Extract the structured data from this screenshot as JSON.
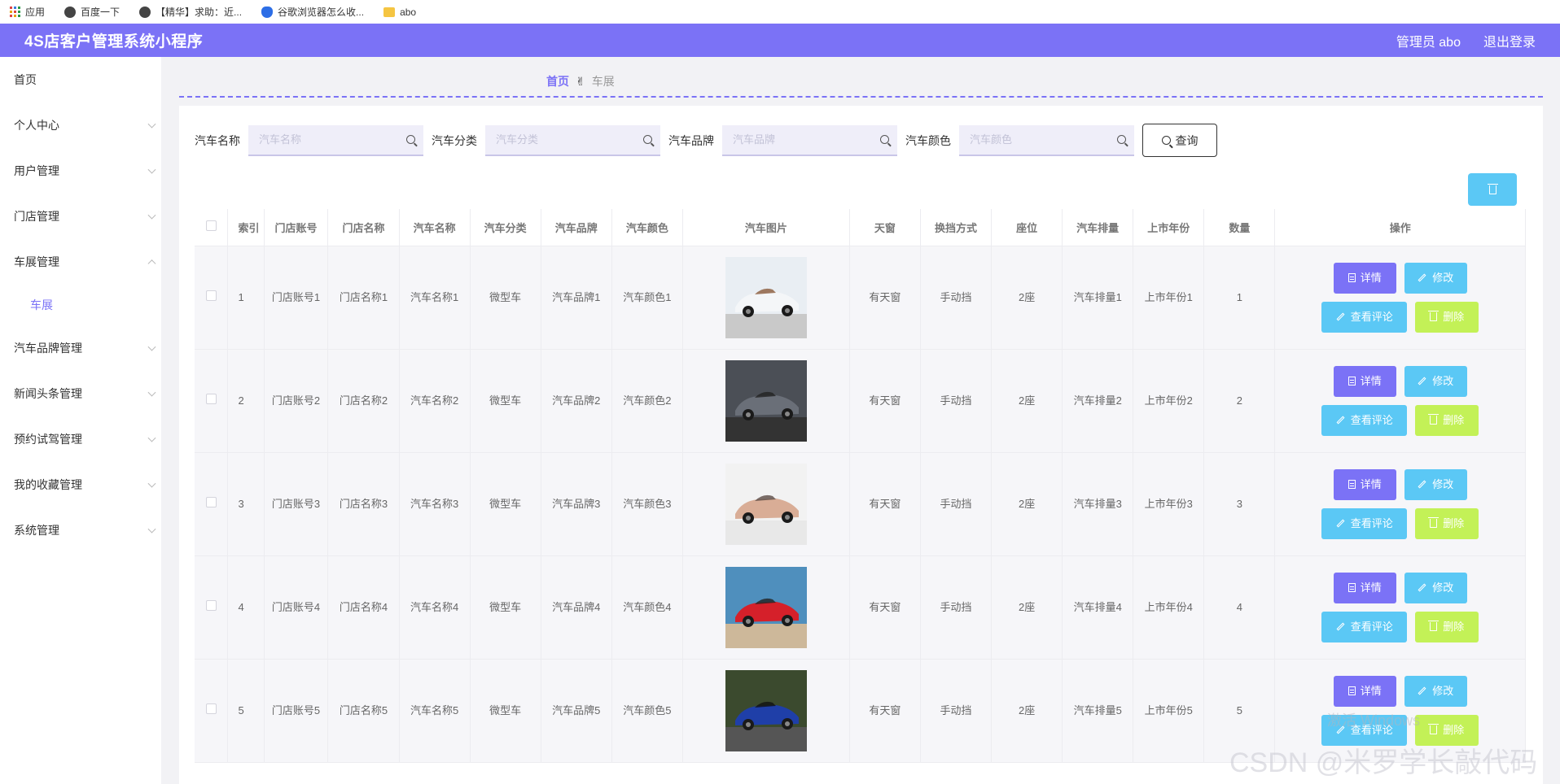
{
  "bookmarks": [
    {
      "label": "应用",
      "icon": "apps-grid-icon"
    },
    {
      "label": "百度一下",
      "icon": "globe-icon"
    },
    {
      "label": "【精华】求助：近...",
      "icon": "globe-icon"
    },
    {
      "label": "谷歌浏览器怎么收...",
      "icon": "baidu-paw-icon"
    },
    {
      "label": "abo",
      "icon": "folder-icon"
    }
  ],
  "header": {
    "title": "4S店客户管理系统小程序",
    "admin_label": "管理员 abo",
    "logout_label": "退出登录",
    "color": "#7b72f6"
  },
  "sidebar": {
    "items": [
      {
        "label": "首页",
        "expandable": false
      },
      {
        "label": "个人中心",
        "expandable": true
      },
      {
        "label": "用户管理",
        "expandable": true
      },
      {
        "label": "门店管理",
        "expandable": true
      },
      {
        "label": "车展管理",
        "expandable": true,
        "expanded": true
      },
      {
        "label": "车展",
        "sub": true,
        "active": true
      },
      {
        "label": "汽车品牌管理",
        "expandable": true
      },
      {
        "label": "新闻头条管理",
        "expandable": true
      },
      {
        "label": "预约试驾管理",
        "expandable": true
      },
      {
        "label": "我的收藏管理",
        "expandable": true
      },
      {
        "label": "系统管理",
        "expandable": true
      }
    ]
  },
  "breadcrumb": {
    "home": "首页",
    "separator": "✌",
    "current": "车展"
  },
  "search": {
    "fields": [
      {
        "label": "汽车名称",
        "placeholder": "汽车名称",
        "value": ""
      },
      {
        "label": "汽车分类",
        "placeholder": "汽车分类",
        "value": ""
      },
      {
        "label": "汽车品牌",
        "placeholder": "汽车品牌",
        "value": ""
      },
      {
        "label": "汽车颜色",
        "placeholder": "汽车颜色",
        "value": ""
      }
    ],
    "query_label": "查询"
  },
  "table": {
    "headers": [
      "",
      "索引",
      "门店账号",
      "门店名称",
      "汽车名称",
      "汽车分类",
      "汽车品牌",
      "汽车颜色",
      "汽车图片",
      "天窗",
      "换挡方式",
      "座位",
      "汽车排量",
      "上市年份",
      "数量",
      "操作"
    ],
    "rows": [
      {
        "index": "1",
        "store_account": "门店账号1",
        "store_name": "门店名称1",
        "car_name": "汽车名称1",
        "category": "微型车",
        "brand": "汽车品牌1",
        "color": "汽车颜色1",
        "image": "white-convertible",
        "sunroof": "有天窗",
        "gear": "手动挡",
        "seats": "2座",
        "displacement": "汽车排量1",
        "year": "上市年份1",
        "quantity": "1"
      },
      {
        "index": "2",
        "store_account": "门店账号2",
        "store_name": "门店名称2",
        "car_name": "汽车名称2",
        "category": "微型车",
        "brand": "汽车品牌2",
        "color": "汽车颜色2",
        "image": "grey-roadster",
        "sunroof": "有天窗",
        "gear": "手动挡",
        "seats": "2座",
        "displacement": "汽车排量2",
        "year": "上市年份2",
        "quantity": "2"
      },
      {
        "index": "3",
        "store_account": "门店账号3",
        "store_name": "门店名称3",
        "car_name": "汽车名称3",
        "category": "微型车",
        "brand": "汽车品牌3",
        "color": "汽车颜色3",
        "image": "rose-gold-coupe",
        "sunroof": "有天窗",
        "gear": "手动挡",
        "seats": "2座",
        "displacement": "汽车排量3",
        "year": "上市年份3",
        "quantity": "3"
      },
      {
        "index": "4",
        "store_account": "门店账号4",
        "store_name": "门店名称4",
        "car_name": "汽车名称4",
        "category": "微型车",
        "brand": "汽车品牌4",
        "color": "汽车颜色4",
        "image": "red-convertible",
        "sunroof": "有天窗",
        "gear": "手动挡",
        "seats": "2座",
        "displacement": "汽车排量4",
        "year": "上市年份4",
        "quantity": "4"
      },
      {
        "index": "5",
        "store_account": "门店账号5",
        "store_name": "门店名称5",
        "car_name": "汽车名称5",
        "category": "微型车",
        "brand": "汽车品牌5",
        "color": "汽车颜色5",
        "image": "blue-coupe",
        "sunroof": "有天窗",
        "gear": "手动挡",
        "seats": "2座",
        "displacement": "汽车排量5",
        "year": "上市年份5",
        "quantity": "5"
      }
    ],
    "actions": {
      "detail": "详情",
      "edit": "修改",
      "comment": "查看评论",
      "delete": "删除"
    }
  },
  "watermark": "CSDN @米罗学长敲代码",
  "windows_activation": "激活 Windows",
  "colors": {
    "primary": "#7b72f6",
    "cyan": "#5bc8f5",
    "lime": "#c3f157"
  }
}
